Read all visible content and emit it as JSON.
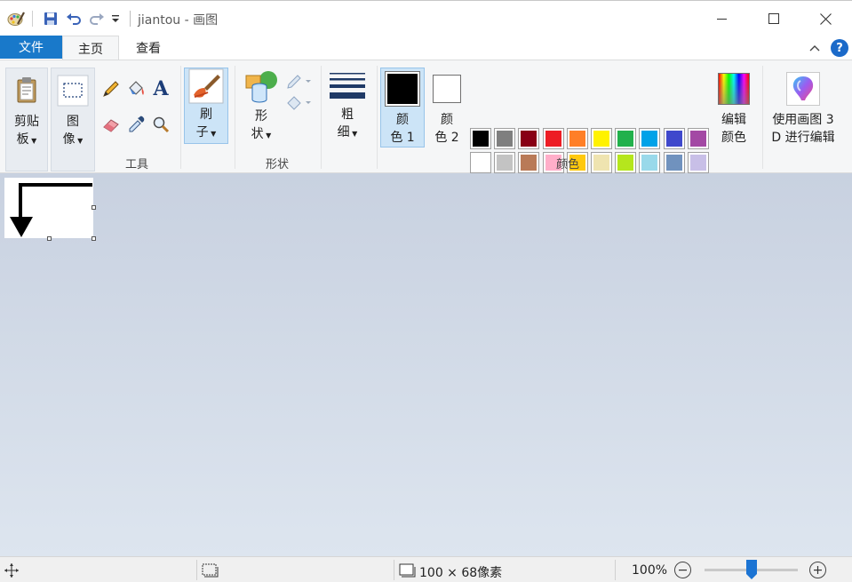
{
  "window": {
    "title": "jiantou - 画图",
    "minimize_icon": "minimize-icon",
    "maximize_icon": "maximize-icon",
    "close_icon": "close-icon"
  },
  "quick_access": {
    "app_icon": "paint-palette-icon",
    "save_icon": "save-icon",
    "undo_icon": "undo-icon",
    "redo_icon": "redo-icon",
    "customize_icon": "dropdown-arrow-icon"
  },
  "tabs": {
    "file": "文件",
    "home": "主页",
    "view": "查看"
  },
  "ribbon": {
    "clipboard": {
      "label_line1": "剪贴",
      "label_line2": "板"
    },
    "image": {
      "label_line1": "图",
      "label_line2": "像"
    },
    "tools_group": "工具",
    "brush": {
      "label_line1": "刷",
      "label_line2": "子"
    },
    "shapes": {
      "label_line1": "形",
      "label_line2": "状"
    },
    "shapes_group": "形状",
    "size": {
      "label_line1": "粗",
      "label_line2": "细"
    },
    "color1": {
      "label_line1": "颜",
      "label_line2": "色 1",
      "color": "#000000"
    },
    "color2": {
      "label_line1": "颜",
      "label_line2": "色 2",
      "color": "#ffffff"
    },
    "colors_group": "颜色",
    "edit_colors": {
      "label_line1": "编辑",
      "label_line2": "颜色"
    },
    "paint3d": {
      "label_line1": "使用画图 3",
      "label_line2": "D 进行编辑"
    },
    "palette_row1": [
      "#000000",
      "#7f7f7f",
      "#880015",
      "#ed1c24",
      "#ff7f27",
      "#fff200",
      "#22b14c",
      "#00a2e8",
      "#3f48cc",
      "#a349a4"
    ],
    "palette_row2": [
      "#ffffff",
      "#c3c3c3",
      "#b97a57",
      "#ffaec9",
      "#ffc90e",
      "#efe4b0",
      "#b5e61d",
      "#99d9ea",
      "#7092be",
      "#c8bfe7"
    ]
  },
  "status": {
    "image_size": "100 × 68像素",
    "zoom": "100%",
    "zoom_level": 0.5
  }
}
